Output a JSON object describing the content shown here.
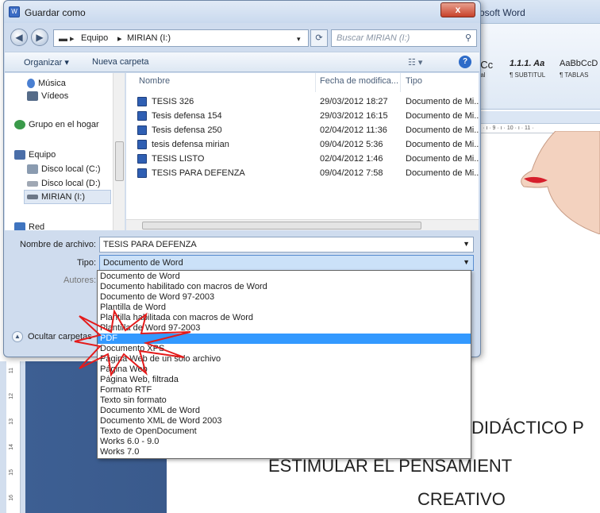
{
  "word": {
    "title_fragment": "rosoft Word",
    "styles": [
      {
        "sample": "bCc",
        "caption": "rmal"
      },
      {
        "sample": "1.1.1. Aa",
        "caption": "¶ SUBTITUL"
      },
      {
        "sample": "AaBbCcD",
        "caption": "¶ TABLAS"
      }
    ],
    "ruler_text": "· 8 · ı · 9 · ı · 10 · ı · 11 ·",
    "vruler_marks": [
      "11",
      "12",
      "13",
      "14",
      "15",
      "16"
    ],
    "doc_lines": [
      "DIDÁCTICO P",
      "ESTIMULAR EL PENSAMIENT",
      "CREATIVO"
    ]
  },
  "dialog": {
    "title": "Guardar como",
    "close_label": "x",
    "address": {
      "crumbs": [
        "Equipo",
        "MIRIAN (I:)"
      ],
      "search_placeholder": "Buscar MIRIAN (I:)"
    },
    "toolbar": {
      "organize_label": "Organizar ▾",
      "new_folder_label": "Nueva carpeta",
      "view_label": "☷ ▾",
      "help_label": "?"
    },
    "nav": [
      {
        "label": "Música",
        "color": "#4a7fd1"
      },
      {
        "label": "Vídeos",
        "color": "#556b88"
      },
      {
        "label": "Grupo en el hogar",
        "color": "#3a9a4a"
      },
      {
        "label": "Equipo",
        "color": "#4a6ea8"
      },
      {
        "label": "Disco local (C:)",
        "color": "#8a9bb0"
      },
      {
        "label": "Disco local (D:)",
        "color": "#a0a8b4"
      },
      {
        "label": "MIRIAN (I:)",
        "color": "#6c7787"
      },
      {
        "label": "Red",
        "color": "#3f74bf"
      }
    ],
    "columns": {
      "name": "Nombre",
      "date": "Fecha de modifica...",
      "type": "Tipo"
    },
    "files": [
      {
        "name": "TESIS 326",
        "date": "29/03/2012 18:27",
        "type": "Documento de Mi..."
      },
      {
        "name": "Tesis defensa  154",
        "date": "29/03/2012 16:15",
        "type": "Documento de Mi..."
      },
      {
        "name": "Tesis defensa  250",
        "date": "02/04/2012 11:36",
        "type": "Documento de Mi..."
      },
      {
        "name": "tesis defensa mirian",
        "date": "09/04/2012 5:36",
        "type": "Documento de Mi..."
      },
      {
        "name": "TESIS LISTO",
        "date": "02/04/2012 1:46",
        "type": "Documento de Mi..."
      },
      {
        "name": "TESIS PARA DEFENZA",
        "date": "09/04/2012 7:58",
        "type": "Documento de Mi..."
      }
    ],
    "filename_label": "Nombre de archivo:",
    "filename_value": "TESIS PARA DEFENZA",
    "type_label": "Tipo:",
    "type_value": "Documento de Word",
    "authors_label": "Autores:",
    "hide_folders_label": "Ocultar carpetas",
    "type_options": [
      "Documento de Word",
      "Documento habilitado con macros de Word",
      "Documento de Word 97-2003",
      "Plantilla de Word",
      "Plantilla habilitada con macros de Word",
      "Plantilla de Word 97-2003",
      "PDF",
      "Documento XPS",
      "Página Web de un solo archivo",
      "Página Web",
      "Página Web, filtrada",
      "Formato RTF",
      "Texto sin formato",
      "Documento XML de Word",
      "Documento XML de Word 2003",
      "Texto de OpenDocument",
      "Works 6.0 - 9.0",
      "Works 7.0"
    ],
    "highlighted_option": "PDF"
  }
}
